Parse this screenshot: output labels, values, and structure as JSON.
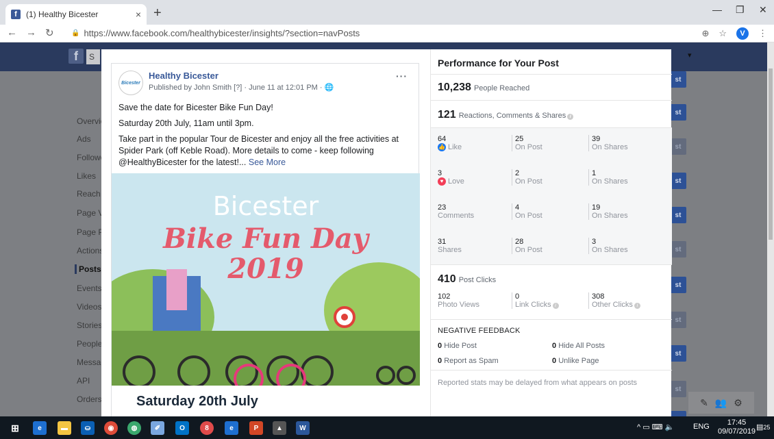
{
  "browser": {
    "tab_title": "(1) Healthy Bicester",
    "url": "https://www.facebook.com/healthybicester/insights/?section=navPosts",
    "profile_initial": "V"
  },
  "sidebar": {
    "items": [
      "Overview",
      "Ads",
      "Followers",
      "Likes",
      "Reach",
      "Page Views",
      "Page Previews",
      "Actions on Page",
      "Posts",
      "Events",
      "Videos",
      "Stories",
      "People",
      "Messages",
      "API",
      "Orders"
    ],
    "active": "Posts"
  },
  "right_buttons": [
    "Boost Post",
    "Boost Post",
    "Boost Post",
    "Boost Post",
    "Boost Post",
    "Boost Post",
    "Boost Post",
    "Boost Post",
    "Boost Post",
    "Boost Post",
    "Boost Post"
  ],
  "post": {
    "page_name": "Healthy Bicester",
    "avatar_text": "Bicester",
    "meta": "Published by John Smith [?] · June 11 at 12:01 PM ·",
    "text1": "Save the date for Bicester Bike Fun Day!",
    "text2": "Saturday 20th July, 11am until 3pm.",
    "text3": "Take part in the popular Tour de Bicester and enjoy all the free activities at Spider Park (off Keble Road). More details to come - keep following @HealthyBicester for the latest!...",
    "see_more": "See More",
    "image_title1": "Bicester",
    "image_title2": "Bike Fun Day",
    "image_title3": "2019",
    "image_date": "Saturday 20th July"
  },
  "stats": {
    "title": "Performance for Your Post",
    "people_reached": "10,238",
    "people_reached_label": "People Reached",
    "reactions": "121",
    "reactions_label": "Reactions, Comments & Shares",
    "like": {
      "total": "64",
      "label": "Like",
      "on_post": "25",
      "on_shares": "39"
    },
    "love": {
      "total": "3",
      "label": "Love",
      "on_post": "2",
      "on_shares": "1"
    },
    "comments": {
      "total": "23",
      "label": "Comments",
      "on_post": "4",
      "on_shares": "19"
    },
    "shares": {
      "total": "31",
      "label": "Shares",
      "on_post": "28",
      "on_shares": "3"
    },
    "on_post_label": "On Post",
    "on_shares_label": "On Shares",
    "post_clicks": "410",
    "post_clicks_label": "Post Clicks",
    "photo_views": "102",
    "photo_views_label": "Photo Views",
    "link_clicks": "0",
    "link_clicks_label": "Link Clicks",
    "other_clicks": "308",
    "other_clicks_label": "Other Clicks",
    "negative_title": "NEGATIVE FEEDBACK",
    "hide_post": "0",
    "hide_post_label": "Hide Post",
    "hide_all": "0",
    "hide_all_label": "Hide All Posts",
    "spam": "0",
    "spam_label": "Report as Spam",
    "unlike": "0",
    "unlike_label": "Unlike Page",
    "note": "Reported stats may be delayed from what appears on posts"
  },
  "taskbar": {
    "lang": "ENG",
    "time": "17:45",
    "date": "09/07/2019",
    "notifications": "25"
  }
}
